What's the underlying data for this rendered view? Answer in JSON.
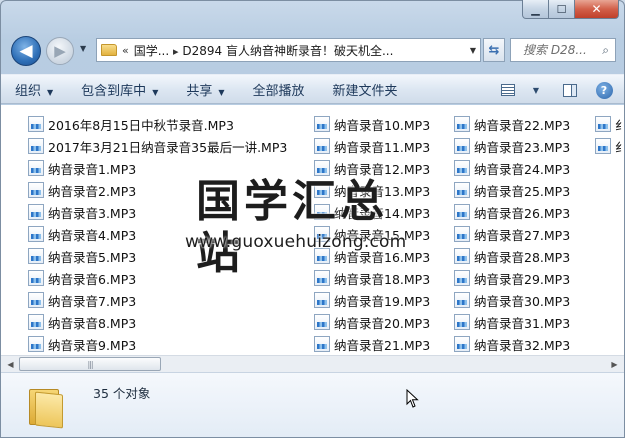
{
  "window": {
    "caption": {
      "minimize": "▁",
      "maximize": "☐",
      "close": "✕"
    }
  },
  "nav": {
    "back_icon": "◀",
    "forward_icon": "▶",
    "address": {
      "chevron": "«",
      "path": [
        "国学...",
        "D2894 盲人纳音神断录音！破天机全..."
      ],
      "separator": "▸"
    },
    "search_placeholder": "搜索 D28...",
    "search_icon": "🔍"
  },
  "toolbar": {
    "items": [
      "组织",
      "包含到库中",
      "共享",
      "全部播放",
      "新建文件夹"
    ],
    "caret": "▼",
    "help": "?"
  },
  "columns": [
    [
      "2016年8月15日中秋节录音.MP3",
      "2017年3月21日纳音录音35最后一讲.MP3",
      "纳音录音1.MP3",
      "纳音录音2.MP3",
      "纳音录音3.MP3",
      "纳音录音4.MP3",
      "纳音录音5.MP3",
      "纳音录音6.MP3",
      "纳音录音7.MP3",
      "纳音录音8.MP3",
      "纳音录音9.MP3"
    ],
    [
      "纳音录音10.MP3",
      "纳音录音11.MP3",
      "纳音录音12.MP3",
      "纳音录音13.MP3",
      "纳音录音14.MP3",
      "纳音录音15.MP3",
      "纳音录音16.MP3",
      "纳音录音18.MP3",
      "纳音录音19.MP3",
      "纳音录音20.MP3",
      "纳音录音21.MP3"
    ],
    [
      "纳音录音22.MP3",
      "纳音录音23.MP3",
      "纳音录音24.MP3",
      "纳音录音25.MP3",
      "纳音录音26.MP3",
      "纳音录音27.MP3",
      "纳音录音28.MP3",
      "纳音录音29.MP3",
      "纳音录音30.MP3",
      "纳音录音31.MP3",
      "纳音录音32.MP3"
    ],
    [
      "纟",
      "纟"
    ]
  ],
  "watermark": {
    "title": "国学汇总站",
    "url": "www.guoxuehuizong.com"
  },
  "scrollbar": {
    "left_arrow": "◀",
    "right_arrow": "▶",
    "grip": "|||"
  },
  "details": {
    "count": "35 个对象"
  }
}
